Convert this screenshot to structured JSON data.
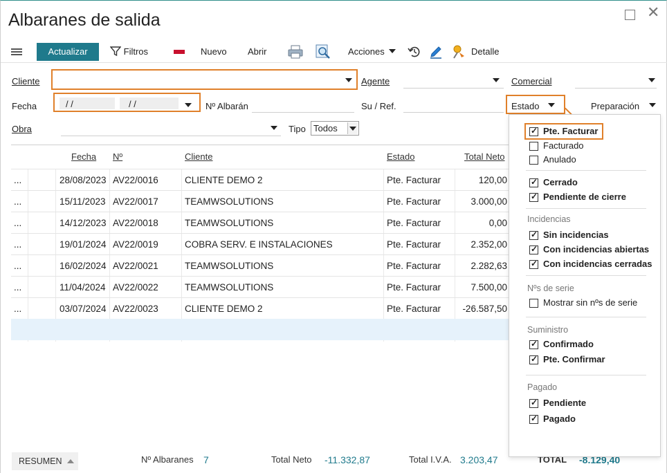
{
  "window": {
    "title": "Albaranes de salida"
  },
  "toolbar": {
    "actualizar": "Actualizar",
    "filtros": "Filtros",
    "nuevo": "Nuevo",
    "abrir": "Abrir",
    "acciones": "Acciones",
    "detalle": "Detalle"
  },
  "filters": {
    "cliente": "Cliente",
    "agente": "Agente",
    "comercial": "Comercial",
    "fecha": "Fecha",
    "fecha_desde": "/ /",
    "fecha_hasta": "/ /",
    "n_albaran": "Nº Albarán",
    "su_ref": "Su / Ref.",
    "estado": "Estado",
    "preparacion": "Preparación",
    "obra": "Obra",
    "tipo": "Tipo",
    "tipo_value": "Todos"
  },
  "table": {
    "columns": [
      "Fecha",
      "Nº",
      "Cliente",
      "Estado",
      "Total Neto"
    ],
    "rows": [
      {
        "more": "...",
        "fecha": "28/08/2023",
        "num": "AV22/0016",
        "cliente": "CLIENTE DEMO 2",
        "estado": "Pte. Facturar",
        "total": "120,00"
      },
      {
        "more": "...",
        "fecha": "15/11/2023",
        "num": "AV22/0017",
        "cliente": "TEAMWSOLUTIONS",
        "estado": "Pte. Facturar",
        "total": "3.000,00"
      },
      {
        "more": "...",
        "fecha": "14/12/2023",
        "num": "AV22/0018",
        "cliente": "TEAMWSOLUTIONS",
        "estado": "Pte. Facturar",
        "total": "0,00"
      },
      {
        "more": "...",
        "fecha": "19/01/2024",
        "num": "AV22/0019",
        "cliente": "COBRA SERV. E INSTALACIONES",
        "estado": "Pte. Facturar",
        "total": "2.352,00"
      },
      {
        "more": "...",
        "fecha": "16/02/2024",
        "num": "AV22/0021",
        "cliente": "TEAMWSOLUTIONS",
        "estado": "Pte. Facturar",
        "total": "2.282,63"
      },
      {
        "more": "...",
        "fecha": "11/04/2024",
        "num": "AV22/0022",
        "cliente": "TEAMWSOLUTIONS",
        "estado": "Pte. Facturar",
        "total": "7.500,00"
      },
      {
        "more": "...",
        "fecha": "03/07/2024",
        "num": "AV22/0023",
        "cliente": "CLIENTE DEMO 2",
        "estado": "Pte. Facturar",
        "total": "-26.587,50"
      }
    ]
  },
  "footer": {
    "resumen": "RESUMEN",
    "n_albaranes_label": "Nº Albaranes",
    "n_albaranes_value": "7",
    "total_neto_label": "Total Neto",
    "total_neto_value": "-11.332,87",
    "total_iva_label": "Total I.V.A.",
    "total_iva_value": "3.203,47",
    "total_label": "TOTAL",
    "total_value": "-8.129,40"
  },
  "estado_dropdown": {
    "items_top": [
      {
        "label": "Pte. Facturar",
        "checked": true,
        "bold": true
      },
      {
        "label": "Facturado",
        "checked": false,
        "bold": false
      },
      {
        "label": "Anulado",
        "checked": false,
        "bold": false
      }
    ],
    "items_cierre": [
      {
        "label": "Cerrado",
        "checked": true,
        "bold": true
      },
      {
        "label": "Pendiente de cierre",
        "checked": true,
        "bold": true
      }
    ],
    "incidencias_title": "Incidencias",
    "items_incidencias": [
      {
        "label": "Sin incidencias",
        "checked": true,
        "bold": true
      },
      {
        "label": "Con incidencias abiertas",
        "checked": true,
        "bold": true
      },
      {
        "label": "Con incidencias cerradas",
        "checked": true,
        "bold": true
      }
    ],
    "series_title": "Nºs de serie",
    "items_series": [
      {
        "label": "Mostrar sin nºs de serie",
        "checked": false,
        "bold": false
      }
    ],
    "suministro_title": "Suministro",
    "items_suministro": [
      {
        "label": "Confirmado",
        "checked": true,
        "bold": true
      },
      {
        "label": "Pte. Confirmar",
        "checked": true,
        "bold": true
      }
    ],
    "pagado_title": "Pagado",
    "items_pagado": [
      {
        "label": "Pendiente",
        "checked": true,
        "bold": true
      },
      {
        "label": "Pagado",
        "checked": true,
        "bold": true
      }
    ]
  },
  "colors": {
    "accent": "#1f7a8c",
    "highlight": "#e0802a",
    "selected_row": "#e6f2fb"
  }
}
